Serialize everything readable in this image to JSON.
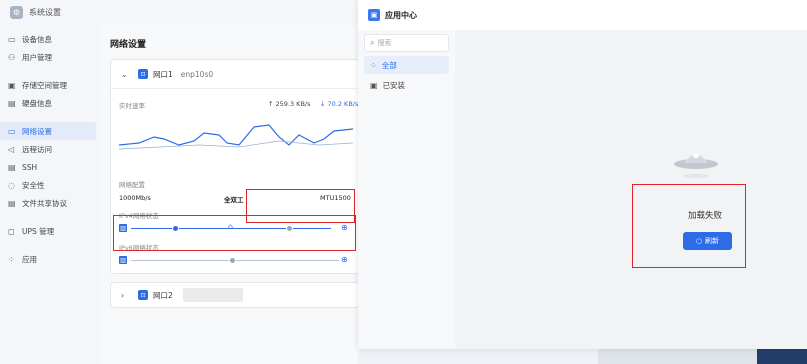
{
  "app": {
    "title": "系统设置"
  },
  "sidebar": {
    "items": [
      {
        "icon": "▭",
        "label": "设备信息"
      },
      {
        "icon": "⚇",
        "label": "用户管理"
      },
      {
        "icon": "▣",
        "label": "存储空间管理"
      },
      {
        "icon": "▤",
        "label": "硬盘信息"
      },
      {
        "icon": "▭",
        "label": "网络设置"
      },
      {
        "icon": "◁",
        "label": "远程访问"
      },
      {
        "icon": "▤",
        "label": "SSH"
      },
      {
        "icon": "◌",
        "label": "安全性"
      },
      {
        "icon": "▤",
        "label": "文件共享协议"
      },
      {
        "icon": "◻",
        "label": "UPS 管理"
      },
      {
        "icon": "⁘",
        "label": "应用"
      }
    ]
  },
  "main": {
    "title": "网络设置",
    "port1": {
      "name": "网口1",
      "iface": "enp10s0",
      "rate_label": "实时速率",
      "upload": "↑ 259.3 KB/s",
      "download": "↓ 70.2 KB/s",
      "config_label": "网络配置",
      "speed": "1000Mb/s",
      "duplex": "全双工",
      "mtu": "MTU1500",
      "ipv4_label": "IPv4网络状态",
      "ipv6_label": "IPv6网络状态"
    },
    "port2": {
      "name": "网口2"
    }
  },
  "app_center": {
    "title": "应用中心",
    "search_placeholder": "搜索",
    "nav": [
      {
        "icon": "⁘",
        "label": "全部"
      },
      {
        "icon": "▣",
        "label": "已安装"
      }
    ],
    "error_text": "加载失败",
    "refresh_label": "刷新"
  },
  "colors": {
    "accent": "#2e6be6",
    "highlight": "#e0242a"
  }
}
